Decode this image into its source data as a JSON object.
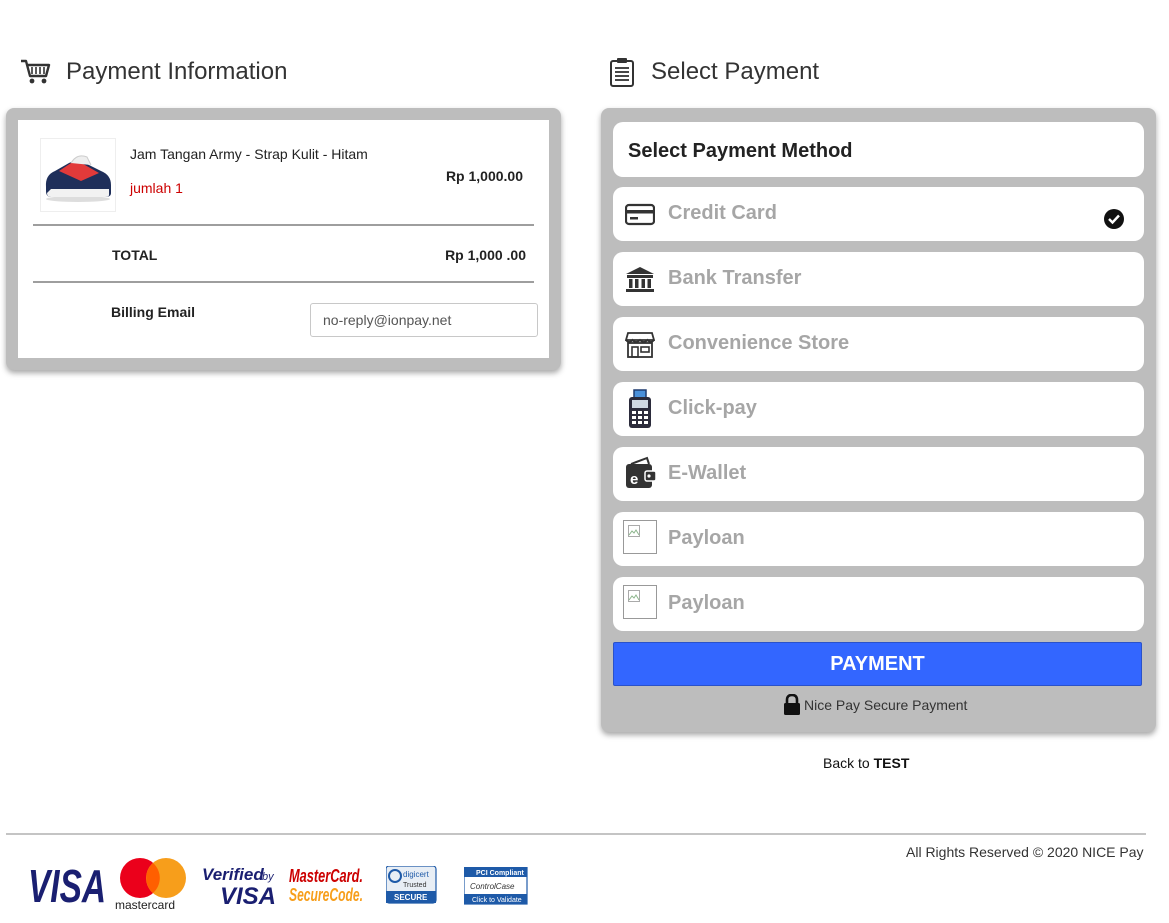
{
  "payment_info": {
    "title": "Payment Information",
    "item": {
      "name": "Jam Tangan Army - Strap Kulit - Hitam",
      "qty_label": "jumlah 1",
      "price": "Rp 1,000.00"
    },
    "total_label": "TOTAL",
    "total_value": "Rp 1,000 .00",
    "billing_email_label": "Billing Email",
    "billing_email_value": "no-reply@ionpay.net"
  },
  "select_payment": {
    "title": "Select Payment",
    "method_header": "Select Payment Method",
    "methods": [
      {
        "label": "Credit Card",
        "icon": "credit-card-icon",
        "selected": true
      },
      {
        "label": "Bank Transfer",
        "icon": "bank-icon",
        "selected": false
      },
      {
        "label": "Convenience Store",
        "icon": "store-icon",
        "selected": false
      },
      {
        "label": "Click-pay",
        "icon": "edc-machine-icon",
        "selected": false
      },
      {
        "label": "E-Wallet",
        "icon": "wallet-icon",
        "selected": false
      },
      {
        "label": "Payloan",
        "icon": "broken-image-icon",
        "selected": false
      },
      {
        "label": "Payloan",
        "icon": "broken-image-icon",
        "selected": false
      }
    ],
    "pay_button": "PAYMENT",
    "secure_note": "Nice Pay Secure Payment"
  },
  "back": {
    "prefix": "Back to ",
    "target": "TEST"
  },
  "footer": {
    "copyright": "All Rights Reserved © 2020 NICE Pay",
    "logos": [
      "VISA",
      "mastercard",
      "Verified by VISA",
      "MasterCard SecureCode.",
      "digicert Trusted SECURE",
      "PCI Compliant ControlCase Click to Validate"
    ]
  },
  "colors": {
    "accent": "#3366ff",
    "panel": "#bdbdbd",
    "qty": "#cc0000",
    "muted_label": "#a6a6a6"
  }
}
